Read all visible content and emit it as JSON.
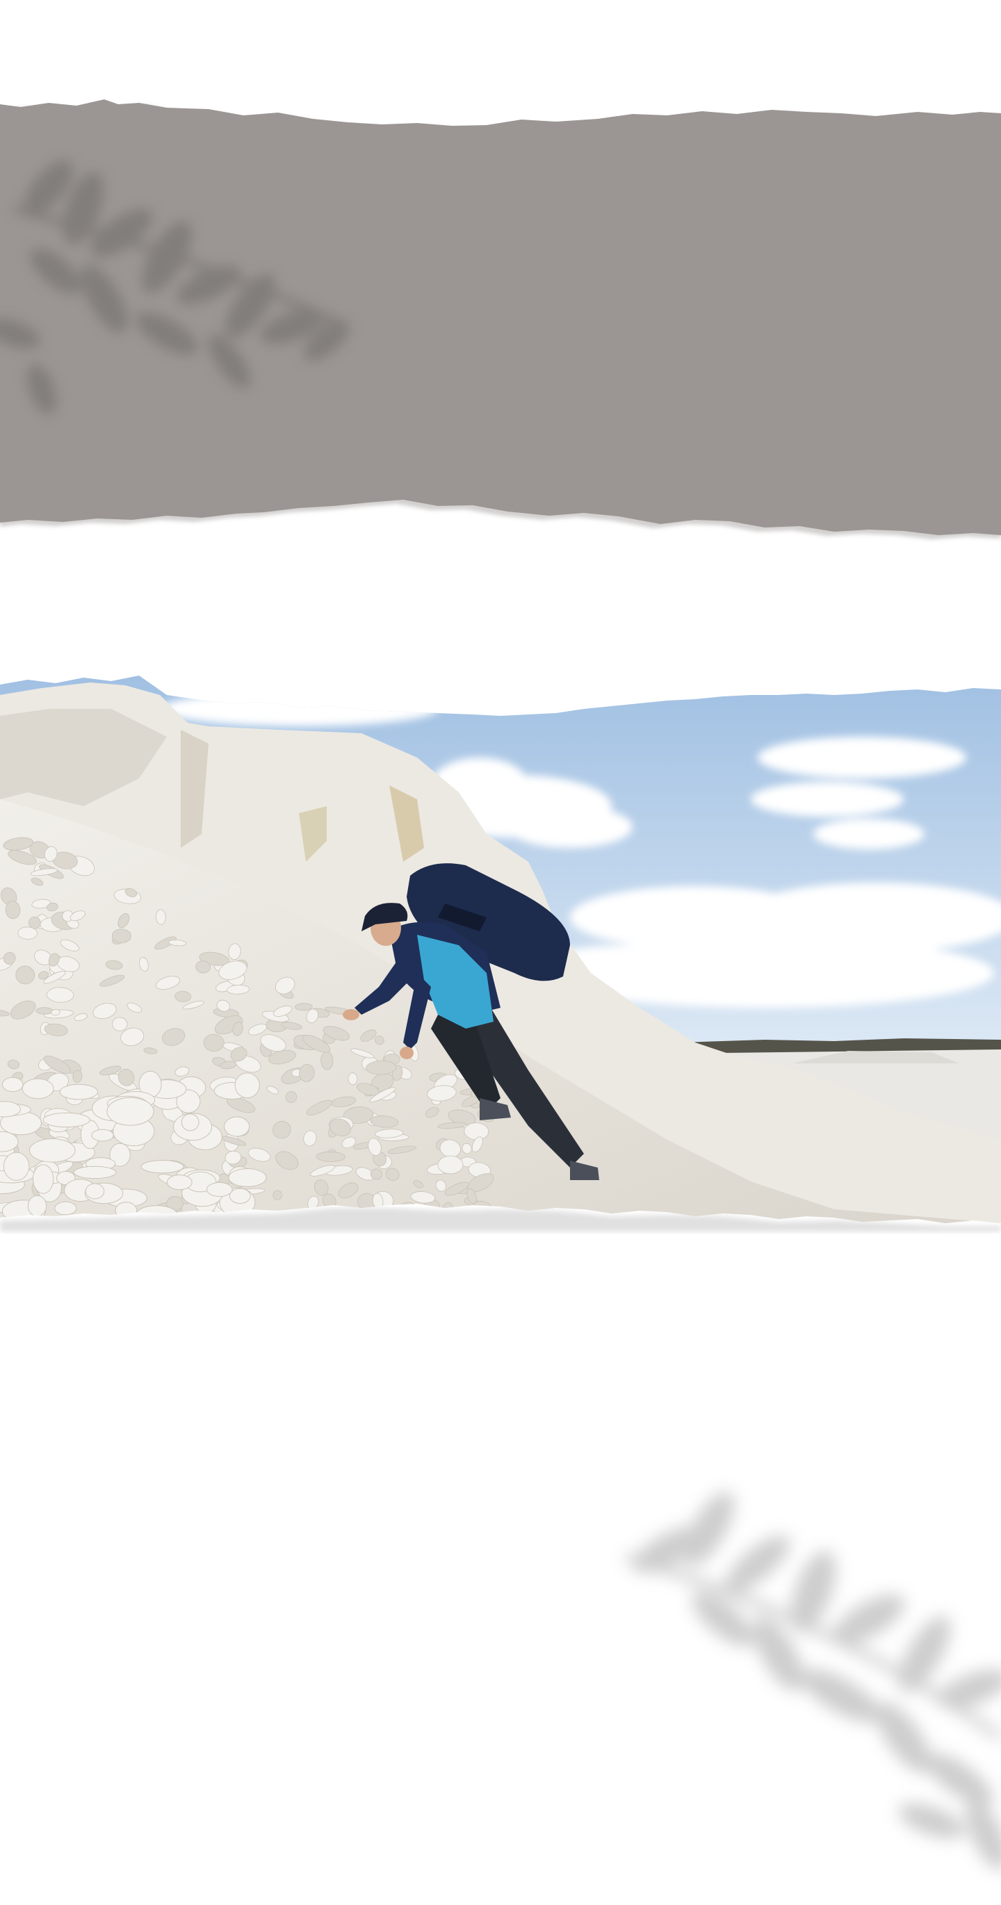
{
  "page": {
    "background_color": "#ffffff"
  },
  "top_band": {
    "paper_color": "#9b9693",
    "paper_shadow_color": "#7e7976",
    "leaf_shadow_icon": "leaf-branch-shadow-icon"
  },
  "hero_photo": {
    "subject": "hiker-climbing-chalk-slope",
    "sky_color_top": "#9fbfe2",
    "sky_color_bottom": "#dde9f5",
    "slope_color": "#e6e3dc",
    "rock_color": "#f4f2ee",
    "jacket_color": "#1f2f57",
    "vest_color": "#3aa7d3",
    "backpack_color": "#1d2b4d"
  },
  "bottom_decor": {
    "leaf_shadow_icon": "leaf-branch-shadow-icon"
  }
}
